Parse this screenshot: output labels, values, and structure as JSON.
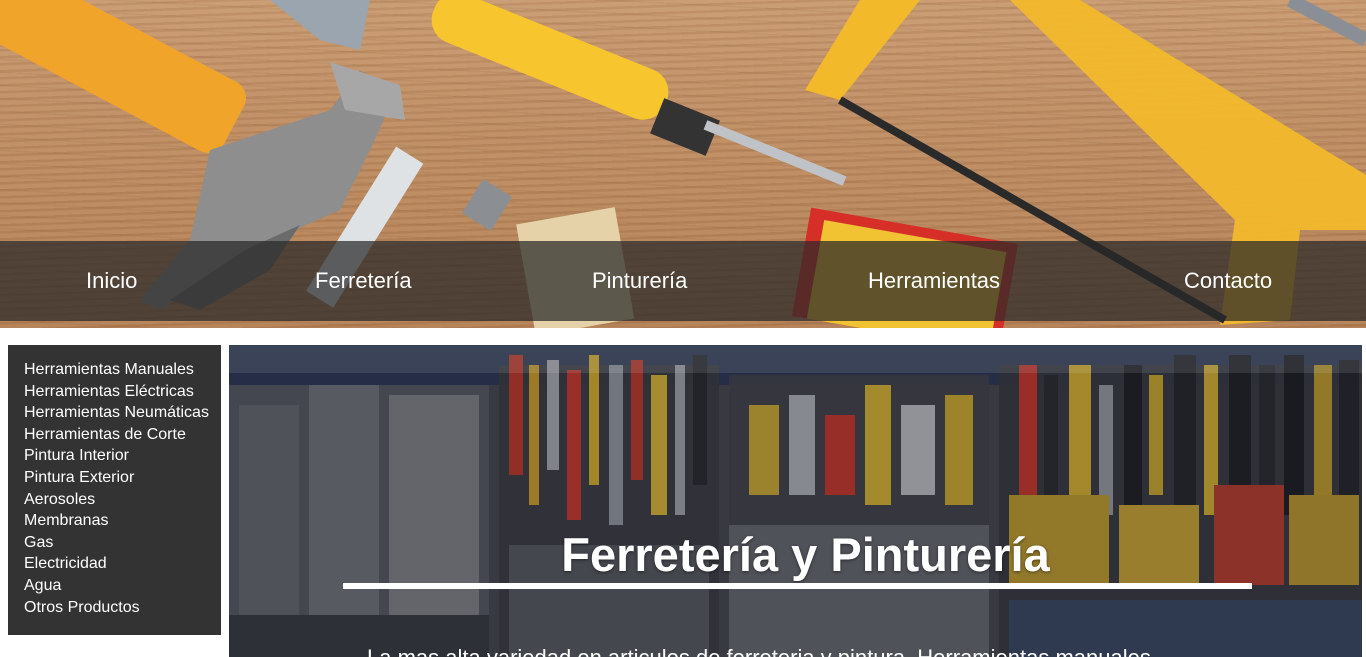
{
  "nav": {
    "items": [
      {
        "label": "Inicio"
      },
      {
        "label": "Ferretería"
      },
      {
        "label": "Pinturería"
      },
      {
        "label": "Herramientas"
      },
      {
        "label": "Contacto"
      }
    ]
  },
  "sidebar": {
    "items": [
      {
        "label": "Herramientas Manuales"
      },
      {
        "label": "Herramientas Eléctricas"
      },
      {
        "label": "Herramientas Neumáticas"
      },
      {
        "label": "Herramientas de Corte"
      },
      {
        "label": "Pintura Interior"
      },
      {
        "label": "Pintura Exterior"
      },
      {
        "label": "Aerosoles"
      },
      {
        "label": "Membranas"
      },
      {
        "label": "Gas"
      },
      {
        "label": "Electricidad"
      },
      {
        "label": "Agua"
      },
      {
        "label": "Otros Productos"
      }
    ]
  },
  "hero": {
    "title": "Ferretería y Pinturería",
    "subtitle": "La mas alta variedad en articulos de ferreteria y pintura. Herramientas manuales"
  },
  "colors": {
    "nav_overlay": "#282828",
    "sidebar_bg": "#333333",
    "text": "#ffffff",
    "tool_yellow": "#f5b82a"
  }
}
